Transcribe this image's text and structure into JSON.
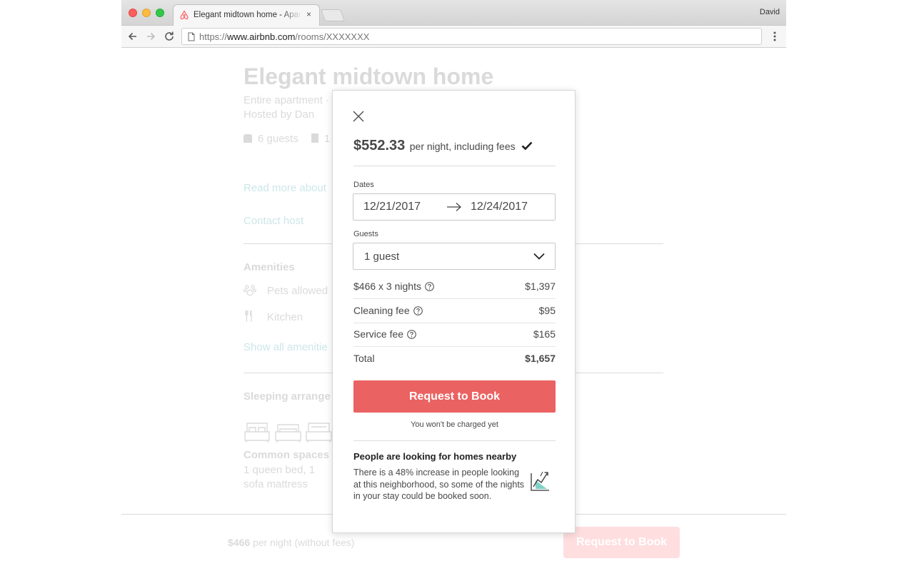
{
  "browser": {
    "tab": {
      "title": "Elegant midtown home - Apart",
      "close": "×"
    },
    "profile": "David",
    "url": {
      "scheme": "https://",
      "host": "www.airbnb.com",
      "path": "/rooms/XXXXXXX"
    }
  },
  "listing": {
    "title": "Elegant midtown home",
    "subtitle": "Entire apartment ·",
    "host": "Hosted by Dan",
    "guests": "6 guests",
    "beds": "1",
    "read_more": "Read more about",
    "contact_host": "Contact host",
    "amenities_title": "Amenities",
    "amenities": [
      "Pets allowed",
      "Kitchen"
    ],
    "show_amenities": "Show all amenitie",
    "sleeping_title": "Sleeping arrange",
    "common_spaces": "Common spaces",
    "beds_desc": "1 queen bed, 1 sofa mattress"
  },
  "bottom_bar": {
    "price": "$466",
    "price_suffix": "per night (without fees)",
    "button": "Request to Book"
  },
  "modal": {
    "price": "$552.33",
    "price_caption": "per night, including fees",
    "dates_label": "Dates",
    "checkin": "12/21/2017",
    "checkout": "12/24/2017",
    "guests_label": "Guests",
    "guests_value": "1 guest",
    "line_items": [
      {
        "label": "$466 x 3 nights",
        "value": "$1,397"
      },
      {
        "label": "Cleaning fee",
        "value": "$95"
      },
      {
        "label": "Service fee",
        "value": "$165"
      },
      {
        "label": "Total",
        "value": "$1,657"
      }
    ],
    "button": "Request to Book",
    "note": "You won't be charged yet",
    "nearby_title": "People are looking for homes nearby",
    "nearby_text": "There is a 48% increase in people looking at this neighborhood, so some of the nights in your stay could be booked soon."
  },
  "colors": {
    "brand": "#ff5a5f",
    "button": "#eb6262",
    "link": "#008489",
    "text": "#484848",
    "trend_fill": "#7fd3c6"
  },
  "icons": [
    "airbnb-logo-icon",
    "back-icon",
    "forward-icon",
    "reload-icon",
    "page-icon",
    "menu-icon",
    "close-icon",
    "check-icon",
    "arrow-right-icon",
    "chevron-down-icon",
    "help-icon",
    "trend-up-icon"
  ]
}
